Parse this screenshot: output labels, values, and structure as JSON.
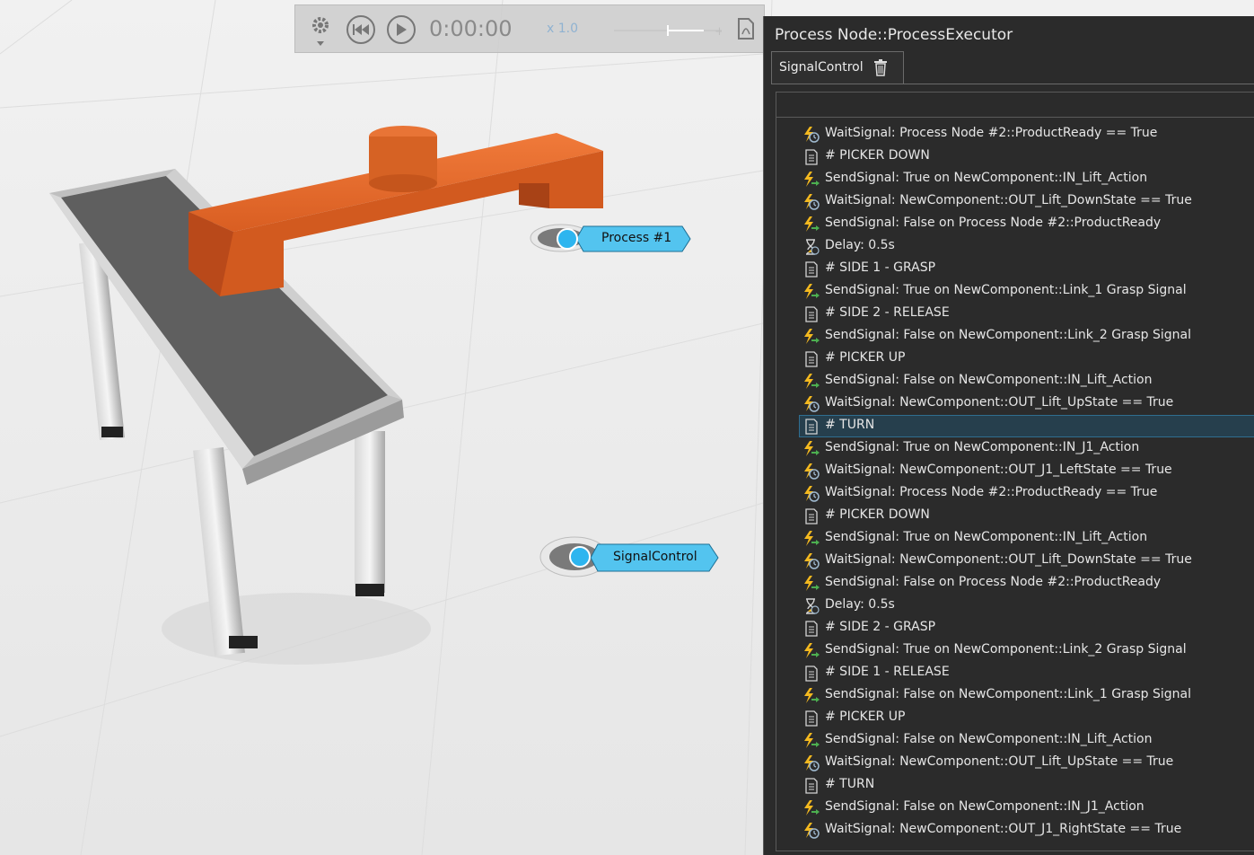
{
  "toolbar": {
    "time": "0:00:00",
    "speed": "x 1.0",
    "icons": [
      "gear-icon",
      "rewind-icon",
      "play-icon",
      "pdf-icon"
    ]
  },
  "panel": {
    "title": "Process Node::ProcessExecutor",
    "tab_label": "SignalControl"
  },
  "nodes": [
    {
      "label": "Process #1"
    },
    {
      "label": "SignalControl"
    }
  ],
  "statements": [
    {
      "type": "wait",
      "text": "WaitSignal: Process Node #2::ProductReady == True"
    },
    {
      "type": "comment",
      "text": "# PICKER DOWN"
    },
    {
      "type": "send",
      "text": "SendSignal: True on NewComponent::IN_Lift_Action"
    },
    {
      "type": "wait",
      "text": "WaitSignal: NewComponent::OUT_Lift_DownState == True"
    },
    {
      "type": "send",
      "text": "SendSignal: False on Process Node #2::ProductReady"
    },
    {
      "type": "delay",
      "text": "Delay: 0.5s"
    },
    {
      "type": "comment",
      "text": "# SIDE 1 - GRASP"
    },
    {
      "type": "send",
      "text": "SendSignal: True on NewComponent::Link_1 Grasp Signal"
    },
    {
      "type": "comment",
      "text": "# SIDE 2 - RELEASE"
    },
    {
      "type": "send",
      "text": "SendSignal: False on NewComponent::Link_2 Grasp Signal"
    },
    {
      "type": "comment",
      "text": "# PICKER UP"
    },
    {
      "type": "send",
      "text": "SendSignal: False on NewComponent::IN_Lift_Action"
    },
    {
      "type": "wait",
      "text": "WaitSignal: NewComponent::OUT_Lift_UpState == True"
    },
    {
      "type": "comment",
      "text": "# TURN",
      "selected": true
    },
    {
      "type": "send",
      "text": "SendSignal: True on NewComponent::IN_J1_Action"
    },
    {
      "type": "wait",
      "text": "WaitSignal: NewComponent::OUT_J1_LeftState == True"
    },
    {
      "type": "wait",
      "text": "WaitSignal: Process Node #2::ProductReady == True"
    },
    {
      "type": "comment",
      "text": "# PICKER DOWN"
    },
    {
      "type": "send",
      "text": "SendSignal: True on NewComponent::IN_Lift_Action"
    },
    {
      "type": "wait",
      "text": "WaitSignal: NewComponent::OUT_Lift_DownState == True"
    },
    {
      "type": "send",
      "text": "SendSignal: False on Process Node #2::ProductReady"
    },
    {
      "type": "delay",
      "text": "Delay: 0.5s"
    },
    {
      "type": "comment",
      "text": "# SIDE 2 - GRASP"
    },
    {
      "type": "send",
      "text": "SendSignal: True on NewComponent::Link_2 Grasp Signal"
    },
    {
      "type": "comment",
      "text": "# SIDE 1 - RELEASE"
    },
    {
      "type": "send",
      "text": "SendSignal: False on NewComponent::Link_1 Grasp Signal"
    },
    {
      "type": "comment",
      "text": "# PICKER UP"
    },
    {
      "type": "send",
      "text": "SendSignal: False on NewComponent::IN_Lift_Action"
    },
    {
      "type": "wait",
      "text": "WaitSignal: NewComponent::OUT_Lift_UpState == True"
    },
    {
      "type": "comment",
      "text": "# TURN"
    },
    {
      "type": "send",
      "text": "SendSignal: False on NewComponent::IN_J1_Action"
    },
    {
      "type": "wait",
      "text": "WaitSignal: NewComponent::OUT_J1_RightState == True"
    }
  ],
  "colors": {
    "accent_blue": "#4fc3f7",
    "picker_orange": "#e2692c",
    "selection": "#263f4d"
  }
}
